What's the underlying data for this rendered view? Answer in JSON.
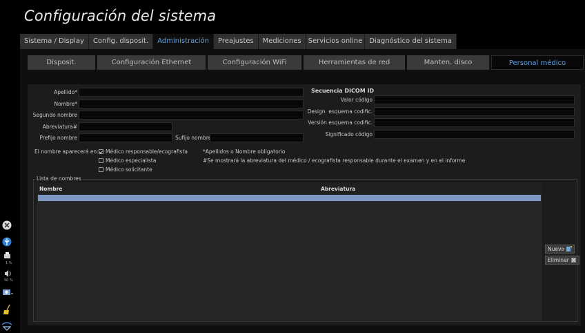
{
  "window": {
    "title": "Configuración del sistema"
  },
  "tabs": [
    {
      "label": "Sistema / Display",
      "active": false
    },
    {
      "label": "Config. disposit.",
      "active": false
    },
    {
      "label": "Administración",
      "active": true
    },
    {
      "label": "Preajustes",
      "active": false
    },
    {
      "label": "Mediciones",
      "active": false
    },
    {
      "label": "Servicios online",
      "active": false
    },
    {
      "label": "Diagnóstico del sistema",
      "active": false
    }
  ],
  "subtabs": [
    {
      "label": "Disposit.",
      "active": false
    },
    {
      "label": "Configuración Ethernet",
      "active": false
    },
    {
      "label": "Configuración WiFi",
      "active": false
    },
    {
      "label": "Herramientas de red",
      "active": false
    },
    {
      "label": "Manten. disco",
      "active": false
    },
    {
      "label": "Personal médico",
      "active": true
    }
  ],
  "form": {
    "apellido_label": "Apellido*",
    "nombre_label": "Nombre*",
    "segundo_label": "Segundo nombre",
    "abreviatura_label": "Abreviatura#",
    "prefijo_label": "Prefijo nombre",
    "sufijo_label": "Sufijo nombre",
    "apellido_value": "",
    "nombre_value": "",
    "segundo_value": "",
    "abreviatura_value": "",
    "prefijo_value": "",
    "sufijo_value": ""
  },
  "dicom": {
    "title": "Secuencia DICOM ID",
    "valor_label": "Valor código",
    "designador_label": "Design. esquema codific.",
    "version_label": "Versión esquema codific.",
    "significado_label": "Significado código"
  },
  "appear": {
    "label": "El nombre aparecerá en:",
    "options": [
      {
        "label": "Médico responsable/ecografista",
        "checked": true
      },
      {
        "label": "Médico especialista",
        "checked": false
      },
      {
        "label": "Médico solicitante",
        "checked": false
      }
    ]
  },
  "notes": {
    "required": "*Apellidos o Nombre obligatorio",
    "abbreviation": "#Se mostrará la abreviatura del médico / ecografista responsable durante el examen y en el informe"
  },
  "names_list": {
    "legend": "Lista de nombres",
    "columns": [
      "Nombre",
      "Abreviatura"
    ],
    "rows": []
  },
  "buttons": {
    "nuevo": "Nuevo",
    "eliminar": "Eliminar"
  },
  "sidebar": {
    "printer_pct": "1 %",
    "volume_pct": "50 %",
    "icons": [
      "close-icon",
      "usb-icon",
      "printer-icon",
      "speaker-icon",
      "camera-icon",
      "broom-icon",
      "wifi-icon"
    ]
  },
  "colors": {
    "accent": "#5fa3e6",
    "selection": "#7c97c1"
  }
}
